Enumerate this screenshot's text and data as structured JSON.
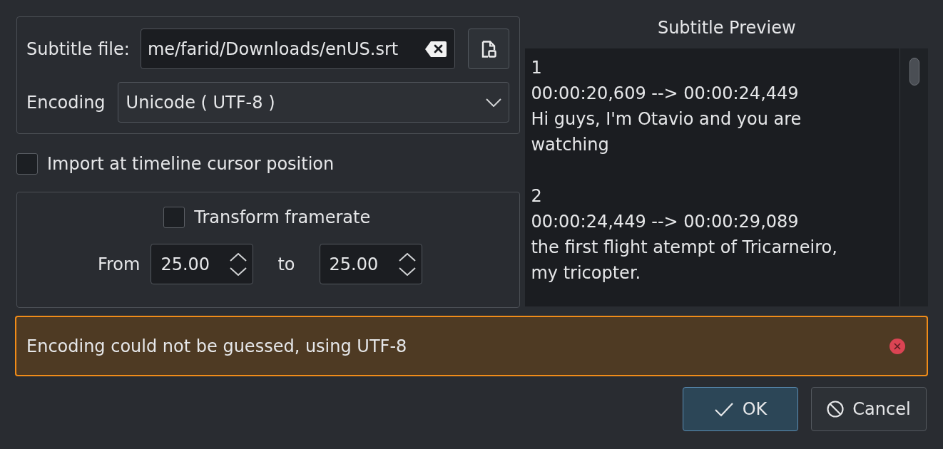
{
  "file_settings": {
    "subtitle_file": {
      "label": "Subtitle file:",
      "value": "me/farid/Downloads/enUS.srt"
    },
    "encoding": {
      "label": "Encoding",
      "value": "Unicode ( UTF-8 )"
    }
  },
  "import_at_cursor": {
    "label": "Import at timeline cursor position",
    "checked": false
  },
  "framerate": {
    "transform": {
      "label": "Transform framerate",
      "checked": false
    },
    "from": {
      "label": "From",
      "value": "25.00"
    },
    "to": {
      "label": "to",
      "value": "25.00"
    }
  },
  "preview": {
    "title": "Subtitle Preview",
    "entries": [
      {
        "number": "1",
        "timing": "00:00:20,609 --> 00:00:24,449",
        "lines": [
          "Hi guys, I'm Otavio and you are",
          "watching"
        ]
      },
      {
        "number": "2",
        "timing": "00:00:24,449 --> 00:00:29,089",
        "lines": [
          "the first flight atempt of Tricarneiro,",
          "my tricopter."
        ]
      }
    ]
  },
  "message": {
    "kind": "warning",
    "text": "Encoding could not be guessed, using UTF-8"
  },
  "buttons": [
    {
      "label": "OK",
      "kind": "ok",
      "default": true
    },
    {
      "label": "Cancel",
      "kind": "cancel",
      "default": false
    }
  ]
}
